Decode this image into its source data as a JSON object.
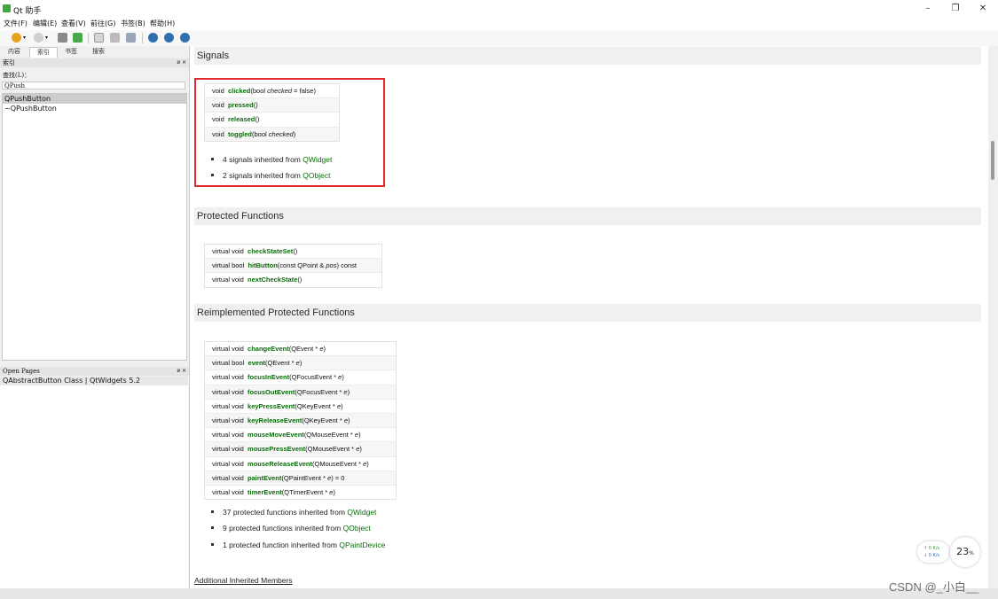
{
  "window": {
    "title": "Qt 助手",
    "minimize": "–",
    "maximize": "❐",
    "close": "✕"
  },
  "menu": [
    "文件(F)",
    "编辑(E)",
    "查看(V)",
    "前往(G)",
    "书签(B)",
    "帮助(H)"
  ],
  "toolbar": {
    "icons": [
      "back-icon",
      "forward-icon",
      "home-icon",
      "sync-icon",
      "copy-icon",
      "print-icon",
      "find-icon",
      "zoom-in-icon",
      "zoom-out-icon",
      "zoom-reset-icon"
    ]
  },
  "left": {
    "tabs": [
      "内容",
      "索引",
      "书签",
      "搜索"
    ],
    "index_title": "索引",
    "find_label": "查找(L)：",
    "search_value": "QPush",
    "index_items": [
      "QPushButton",
      "~QPushButton"
    ],
    "open_pages_title": "Open Pages",
    "open_pages": [
      "QAbstractButton Class | QtWidgets 5.2"
    ],
    "dock_buttons": "ø ×"
  },
  "content": {
    "signals": {
      "title": "Signals",
      "rows": [
        {
          "ret": "void",
          "name": "clicked",
          "args_pre": "(bool ",
          "args_em": "checked",
          "args_post": " = false)"
        },
        {
          "ret": "void",
          "name": "pressed",
          "args_pre": "()",
          "args_em": "",
          "args_post": ""
        },
        {
          "ret": "void",
          "name": "released",
          "args_pre": "()",
          "args_em": "",
          "args_post": ""
        },
        {
          "ret": "void",
          "name": "toggled",
          "args_pre": "(bool ",
          "args_em": "checked",
          "args_post": ")"
        }
      ],
      "inherited": [
        {
          "text": "4 signals inherited from ",
          "link": "QWidget"
        },
        {
          "text": "2 signals inherited from ",
          "link": "QObject"
        }
      ]
    },
    "protected": {
      "title": "Protected Functions",
      "rows": [
        {
          "ret": "virtual void",
          "name": "checkStateSet",
          "args_pre": "()",
          "args_em": "",
          "args_post": ""
        },
        {
          "ret": "virtual bool",
          "name": "hitButton",
          "args_pre": "(const QPoint & ",
          "args_em": "pos",
          "args_post": ") const"
        },
        {
          "ret": "virtual void",
          "name": "nextCheckState",
          "args_pre": "()",
          "args_em": "",
          "args_post": ""
        }
      ]
    },
    "reimpl": {
      "title": "Reimplemented Protected Functions",
      "rows": [
        {
          "ret": "virtual void",
          "name": "changeEvent",
          "args_pre": "(QEvent * ",
          "args_em": "e",
          "args_post": ")"
        },
        {
          "ret": "virtual bool",
          "name": "event",
          "args_pre": "(QEvent * ",
          "args_em": "e",
          "args_post": ")"
        },
        {
          "ret": "virtual void",
          "name": "focusInEvent",
          "args_pre": "(QFocusEvent * ",
          "args_em": "e",
          "args_post": ")"
        },
        {
          "ret": "virtual void",
          "name": "focusOutEvent",
          "args_pre": "(QFocusEvent * ",
          "args_em": "e",
          "args_post": ")"
        },
        {
          "ret": "virtual void",
          "name": "keyPressEvent",
          "args_pre": "(QKeyEvent * ",
          "args_em": "e",
          "args_post": ")"
        },
        {
          "ret": "virtual void",
          "name": "keyReleaseEvent",
          "args_pre": "(QKeyEvent * ",
          "args_em": "e",
          "args_post": ")"
        },
        {
          "ret": "virtual void",
          "name": "mouseMoveEvent",
          "args_pre": "(QMouseEvent * ",
          "args_em": "e",
          "args_post": ")"
        },
        {
          "ret": "virtual void",
          "name": "mousePressEvent",
          "args_pre": "(QMouseEvent * ",
          "args_em": "e",
          "args_post": ")"
        },
        {
          "ret": "virtual void",
          "name": "mouseReleaseEvent",
          "args_pre": "(QMouseEvent * ",
          "args_em": "e",
          "args_post": ")"
        },
        {
          "ret": "virtual void",
          "name": "paintEvent",
          "args_pre": "(QPaintEvent * ",
          "args_em": "e",
          "args_post": ") = 0"
        },
        {
          "ret": "virtual void",
          "name": "timerEvent",
          "args_pre": "(QTimerEvent * ",
          "args_em": "e",
          "args_post": ")"
        }
      ],
      "inherited": [
        {
          "text": "37 protected functions inherited from ",
          "link": "QWidget"
        },
        {
          "text": "9 protected functions inherited from ",
          "link": "QObject"
        },
        {
          "text": "1 protected function inherited from ",
          "link": "QPaintDevice"
        }
      ]
    },
    "additional_link": "Additional Inherited Members"
  },
  "overlay": {
    "net_up": "↑ 0  K/s",
    "net_down": "↓ 0  K/s",
    "cpu_value": "23",
    "cpu_unit": "%",
    "watermark": "CSDN @_小白__"
  },
  "colors": {
    "link_green": "#0a6b0a",
    "highlight_red": "#e32b2b"
  }
}
